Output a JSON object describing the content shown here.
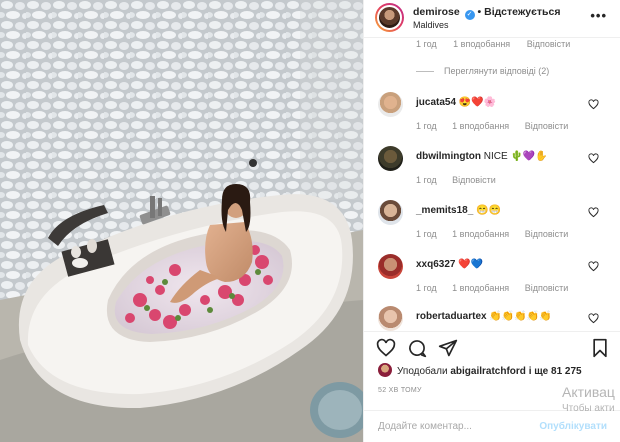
{
  "post": {
    "author": "demirose",
    "follow_label": "• Відстежується",
    "location": "Maldives",
    "more_label": "•••",
    "top_meta": [
      "1 год",
      "1 вподобання",
      "Відповісти"
    ],
    "view_replies": "Переглянути відповіді (2)",
    "comments": [
      {
        "user": "jucata54",
        "text": "😍❤️🌸",
        "meta": [
          "1 год",
          "1 вподобання",
          "Відповісти"
        ]
      },
      {
        "user": "dbwilmington",
        "text": "NICE 🌵💜✋",
        "meta": [
          "1 год",
          "Відповісти"
        ]
      },
      {
        "user": "_memits18_",
        "text": "😁😁",
        "meta": [
          "1 год",
          "1 вподобання",
          "Відповісти"
        ]
      },
      {
        "user": "xxq6327",
        "text": "❤️💙",
        "meta": [
          "1 год",
          "1 вподобання",
          "Відповісти"
        ]
      },
      {
        "user": "robertaduartex",
        "text": "👏👏👏👏👏",
        "meta": []
      }
    ],
    "liked_by_label": "Уподобали",
    "liked_by_user": "abigailratchford",
    "liked_by_rest": "і ще 81 275",
    "timestamp": "52 ХВ ТОМУ",
    "add_comment_placeholder": "Додайте коментар...",
    "post_button": "Опублікувати",
    "watermark": {
      "line1": "Активац",
      "line2": "Чтобы акти"
    }
  }
}
